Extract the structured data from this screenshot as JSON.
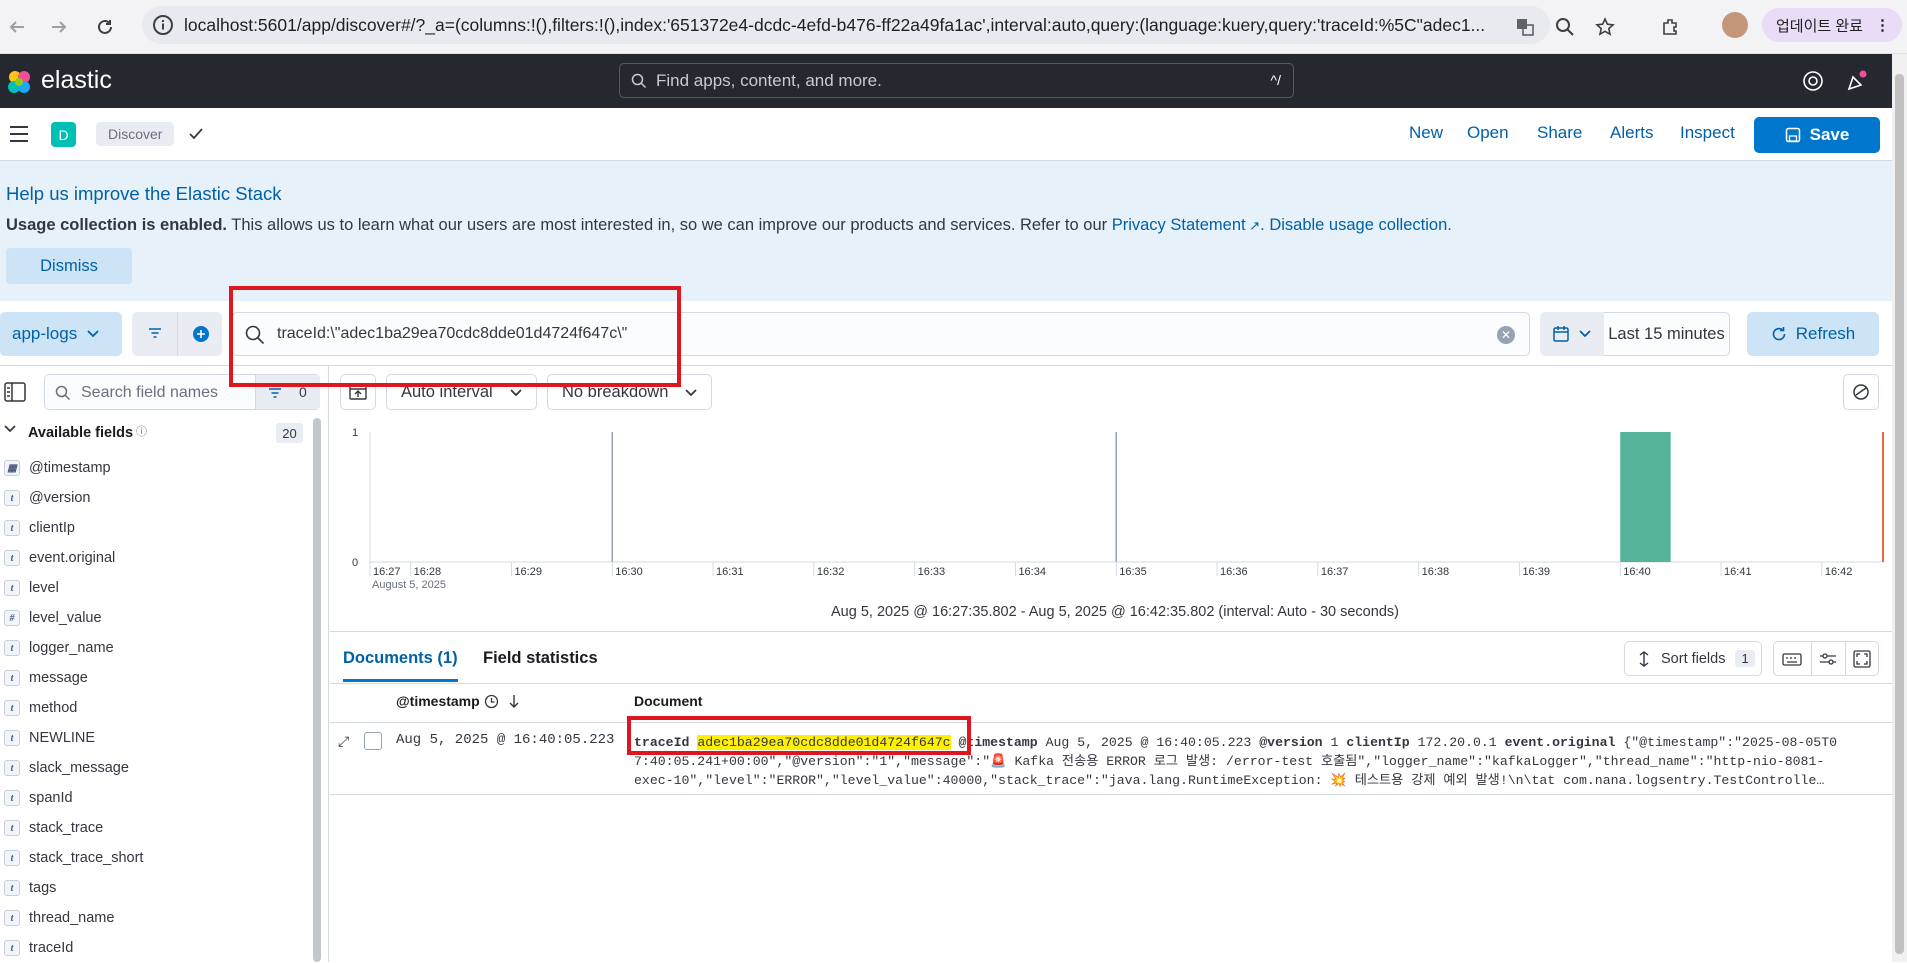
{
  "browser": {
    "url": "localhost:5601/app/discover#/?_a=(columns:!(),filters:!(),index:'651372e4-dcdc-4efd-b476-ff22a49fa1ac',interval:auto,query:(language:kuery,query:'traceId:%5C\"adec1...",
    "update_label": "업데이트 완료"
  },
  "header": {
    "logo_text": "elastic",
    "search_placeholder": "Find apps, content, and more.",
    "search_shortcut": "^/"
  },
  "appbar": {
    "space_letter": "D",
    "breadcrumb": "Discover",
    "links": [
      "New",
      "Open",
      "Share",
      "Alerts",
      "Inspect"
    ],
    "save_label": "Save"
  },
  "callout": {
    "title": "Help us improve the Elastic Stack",
    "bold": "Usage collection is enabled.",
    "body": "This allows us to learn what our users are most interested in, so we can improve our products and services. Refer to our",
    "privacy_link": "Privacy Statement",
    "disable_link": "Disable usage collection.",
    "dismiss_label": "Dismiss"
  },
  "query": {
    "data_view": "app-logs",
    "text": "traceId:\\\"adec1ba29ea70cdc8dde01d4724f647c\\\"",
    "time_range": "Last 15 minutes",
    "refresh_label": "Refresh"
  },
  "sidebar": {
    "search_placeholder": "Search field names",
    "filter_count": "0",
    "section_title": "Available fields",
    "field_count": "20",
    "fields": [
      {
        "name": "@timestamp",
        "type": "date"
      },
      {
        "name": "@version",
        "type": "t"
      },
      {
        "name": "clientIp",
        "type": "t"
      },
      {
        "name": "event.original",
        "type": "t"
      },
      {
        "name": "level",
        "type": "t"
      },
      {
        "name": "level_value",
        "type": "#"
      },
      {
        "name": "logger_name",
        "type": "t"
      },
      {
        "name": "message",
        "type": "t"
      },
      {
        "name": "method",
        "type": "t"
      },
      {
        "name": "NEWLINE",
        "type": "t"
      },
      {
        "name": "slack_message",
        "type": "t"
      },
      {
        "name": "spanId",
        "type": "t"
      },
      {
        "name": "stack_trace",
        "type": "t"
      },
      {
        "name": "stack_trace_short",
        "type": "t"
      },
      {
        "name": "tags",
        "type": "t"
      },
      {
        "name": "thread_name",
        "type": "t"
      },
      {
        "name": "traceId",
        "type": "t"
      }
    ]
  },
  "histogram": {
    "interval_label": "Auto interval",
    "breakdown_label": "No breakdown",
    "y_ticks": [
      "1",
      "0"
    ],
    "x_ticks": [
      "16:27",
      "16:28",
      "16:29",
      "16:30",
      "16:31",
      "16:32",
      "16:33",
      "16:34",
      "16:35",
      "16:36",
      "16:37",
      "16:38",
      "16:39",
      "16:40",
      "16:41",
      "16:42"
    ],
    "date_label": "August 5, 2025",
    "range_text": "Aug 5, 2025 @ 16:27:35.802 - Aug 5, 2025 @ 16:42:35.802 (interval: Auto - 30 seconds)",
    "bar_color": "#54b399"
  },
  "chart_data": {
    "type": "bar",
    "x": [
      "16:40:00"
    ],
    "values": [
      1
    ],
    "ylim": [
      0,
      1
    ],
    "xlabel": "",
    "ylabel": ""
  },
  "documents": {
    "tab_docs": "Documents (1)",
    "tab_stats": "Field statistics",
    "sort_label": "Sort fields",
    "sort_count": "1",
    "col_timestamp": "@timestamp",
    "col_document": "Document",
    "row": {
      "timestamp": "Aug 5, 2025 @ 16:40:05.223",
      "k_traceid": "traceId",
      "v_traceid": "adec1ba29ea70cdc8dde01d4724f647c",
      "k_timestamp": "@timestamp",
      "v_timestamp": "Aug 5, 2025 @ 16:40:05.223",
      "k_version": "@version",
      "v_version": "1",
      "k_clientip": "clientIp",
      "v_clientip": "172.20.0.1",
      "k_event": "event.original",
      "v_event_1": "{\"@timestamp\":\"2025-08-05T0",
      "line2": "7:40:05.241+00:00\",\"@version\":\"1\",\"message\":\"🚨 Kafka 전송용 ERROR 로그 발생: /error-test 호출됨\",\"logger_name\":\"kafkaLogger\",\"thread_name\":\"http-nio-8081-",
      "line3": "exec-10\",\"level\":\"ERROR\",\"level_value\":40000,\"stack_trace\":\"java.lang.RuntimeException: 💥 테스트용 강제 예외 발생!\\n\\tat com.nana.logsentry.TestControlle…"
    }
  },
  "colors": {
    "primary": "#0077cc",
    "header_bg": "#25282f",
    "highlight": "#ffef00",
    "annotation_red": "#e0161e"
  }
}
